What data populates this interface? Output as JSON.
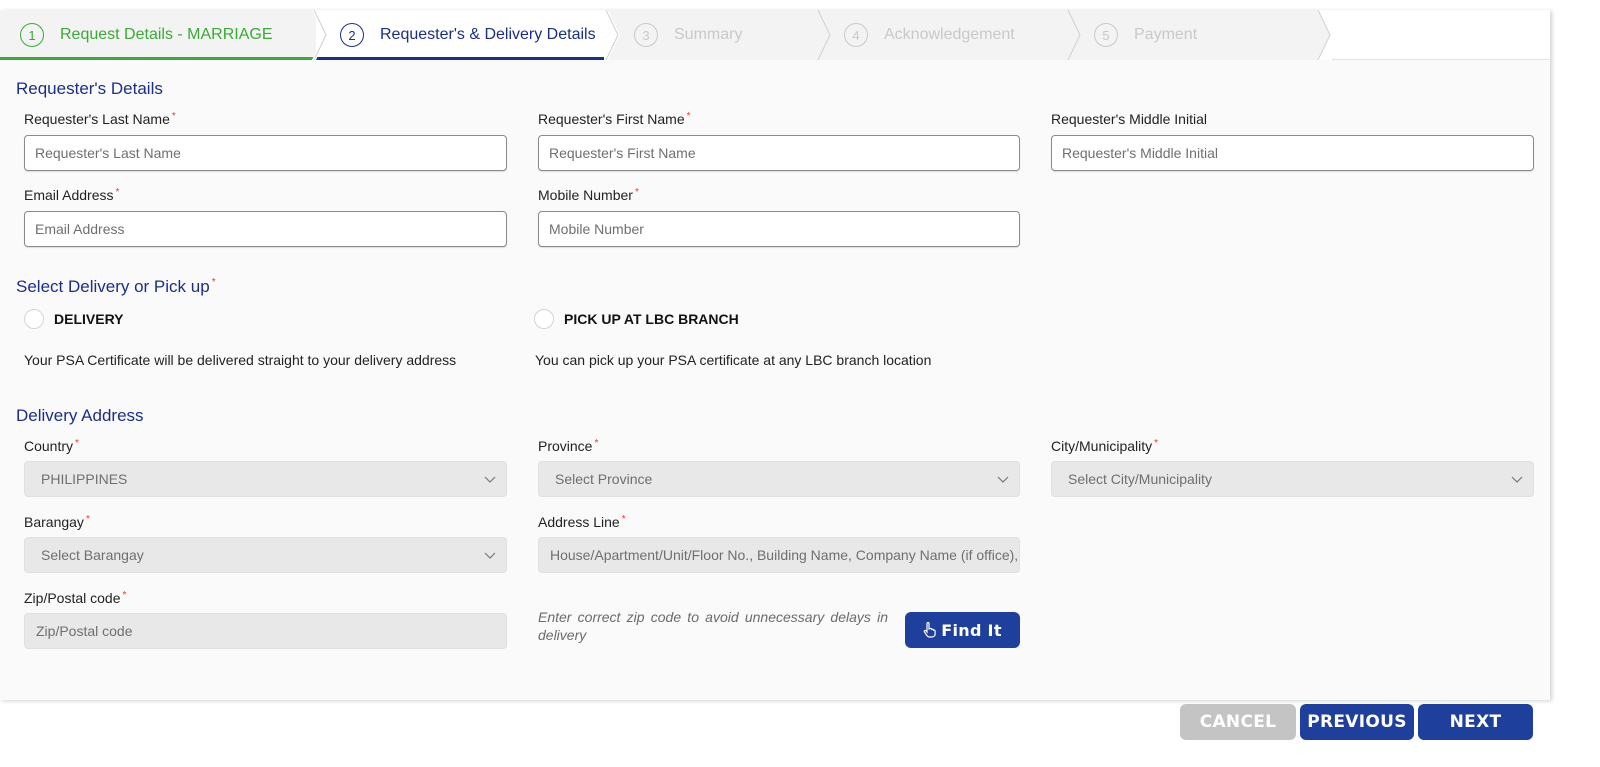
{
  "stepper": {
    "steps": [
      {
        "num": "1",
        "label": "Request Details - MARRIAGE",
        "state": "done"
      },
      {
        "num": "2",
        "label": "Requester's & Delivery Details",
        "state": "active"
      },
      {
        "num": "3",
        "label": "Summary",
        "state": "pending"
      },
      {
        "num": "4",
        "label": "Acknowledgement",
        "state": "pending"
      },
      {
        "num": "5",
        "label": "Payment",
        "state": "pending"
      }
    ]
  },
  "requester": {
    "title": "Requester's Details",
    "last_name": {
      "label": "Requester's Last Name",
      "placeholder": "Requester's Last Name",
      "required": "*"
    },
    "first_name": {
      "label": "Requester's First Name",
      "placeholder": "Requester's First Name",
      "required": "*"
    },
    "middle_initial": {
      "label": "Requester's Middle Initial",
      "placeholder": "Requester's Middle Initial"
    },
    "email": {
      "label": "Email Address",
      "placeholder": "Email Address",
      "required": "*"
    },
    "mobile": {
      "label": "Mobile Number",
      "placeholder": "Mobile Number",
      "required": "*"
    }
  },
  "delivery_choice": {
    "title": "Select Delivery or Pick up",
    "required": "*",
    "options": [
      {
        "label": "DELIVERY",
        "description": "Your PSA Certificate will be delivered straight to your delivery address"
      },
      {
        "label": "PICK UP AT LBC BRANCH",
        "description": "You can pick up your PSA certificate at any LBC branch location"
      }
    ]
  },
  "address": {
    "title": "Delivery Address",
    "country": {
      "label": "Country",
      "value": "PHILIPPINES",
      "required": "*"
    },
    "province": {
      "label": "Province",
      "value": "Select Province",
      "required": "*"
    },
    "city": {
      "label": "City/Municipality",
      "value": "Select City/Municipality",
      "required": "*"
    },
    "barangay": {
      "label": "Barangay",
      "value": "Select Barangay",
      "required": "*"
    },
    "address_line": {
      "label": "Address Line",
      "placeholder": "House/Apartment/Unit/Floor No., Building Name, Company Name (if office),",
      "required": "*"
    },
    "zip": {
      "label": "Zip/Postal code",
      "placeholder": "Zip/Postal code",
      "required": "*"
    },
    "zip_hint": "Enter correct zip code to avoid unnecessary delays in delivery",
    "find_button": "Find It"
  },
  "footer": {
    "cancel": "CANCEL",
    "previous": "PREVIOUS",
    "next": "NEXT"
  },
  "colors": {
    "brand_blue": "#1e3f9c",
    "step_done": "#3aaa35",
    "required": "#e53935"
  }
}
